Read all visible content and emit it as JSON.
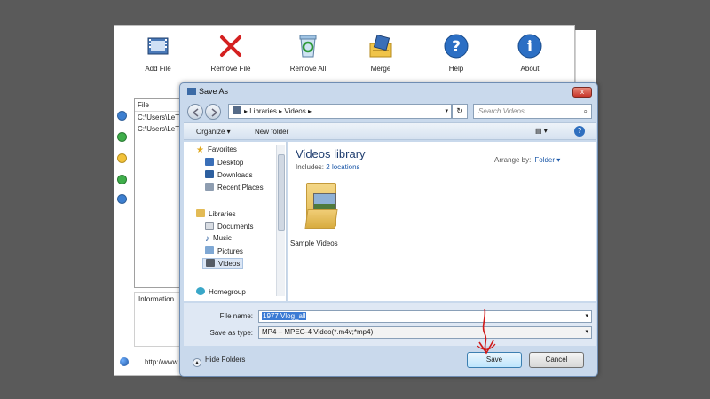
{
  "app": {
    "toolbar": [
      {
        "label": "Add File",
        "icon": "film-add-icon"
      },
      {
        "label": "Remove File",
        "icon": "red-x-icon"
      },
      {
        "label": "Remove All",
        "icon": "recycle-bin-icon"
      },
      {
        "label": "Merge",
        "icon": "merge-icon"
      },
      {
        "label": "Help",
        "icon": "help-icon"
      },
      {
        "label": "About",
        "icon": "info-icon"
      }
    ],
    "file_panel": {
      "header": "File",
      "rows": [
        "C:\\Users\\LeTh",
        "C:\\Users\\LeTh"
      ]
    },
    "info_label": "Information",
    "url_text": "http://www."
  },
  "dialog": {
    "title": "Save As",
    "close": "x",
    "breadcrumb": [
      "Libraries",
      "Videos"
    ],
    "search_placeholder": "Search Videos",
    "commands": {
      "organize": "Organize ▾",
      "new_folder": "New folder"
    },
    "nav": {
      "favorites": "Favorites",
      "favorites_items": [
        "Desktop",
        "Downloads",
        "Recent Places"
      ],
      "libraries": "Libraries",
      "libraries_items": [
        "Documents",
        "Music",
        "Pictures",
        "Videos"
      ],
      "homegroup": "Homegroup"
    },
    "library": {
      "title": "Videos library",
      "includes_label": "Includes:",
      "includes_link": "2 locations",
      "arrange_label": "Arrange by:",
      "arrange_value": "Folder ▾",
      "folder_name": "Sample Videos"
    },
    "file_name_label": "File name:",
    "file_name_value": "1977 Vlog_all",
    "save_type_label": "Save as type:",
    "save_type_value": "MP4 – MPEG-4 Video(*.m4v;*mp4)",
    "hide_folders": "Hide Folders",
    "save_button": "Save",
    "cancel_button": "Cancel"
  },
  "colors": {
    "accent": "#3b7bd4",
    "dialog_frame": "#c9d9ec",
    "close_red": "#c7362a",
    "annotation_red": "#d01818"
  }
}
